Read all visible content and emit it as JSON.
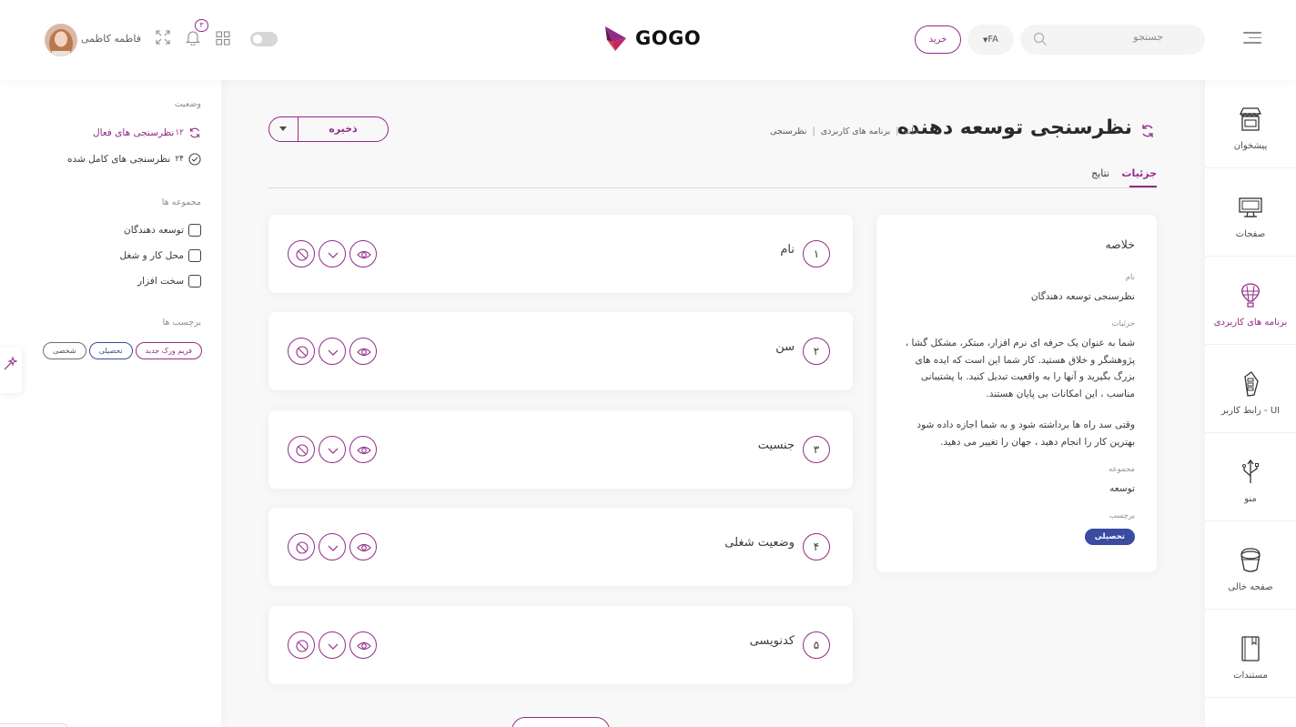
{
  "header": {
    "search_placeholder": "جستجو",
    "language": "FA",
    "buy_label": "خرید",
    "logo_text": "GOGO",
    "notification_count": "۳",
    "user_name": "فاطمه کاظمی"
  },
  "sidebar": {
    "items": [
      {
        "label": "پیشخوان",
        "icon": "shop-icon"
      },
      {
        "label": "صفحات",
        "icon": "monitor-icon"
      },
      {
        "label": "برنامه های کاربردی",
        "icon": "balloon-icon",
        "active": true
      },
      {
        "label": "رابط کاربر - UI",
        "icon": "remote-icon"
      },
      {
        "label": "منو",
        "icon": "usb-icon"
      },
      {
        "label": "صفحه خالی",
        "icon": "bucket-icon"
      },
      {
        "label": "مستندات",
        "icon": "book-icon"
      }
    ]
  },
  "left_panel": {
    "status_heading": "وضعیت",
    "status_items": [
      {
        "count": "۱۲",
        "label": "نظرسنجی های فعال",
        "active": true
      },
      {
        "count": "۲۴",
        "label": "نظرسنجی های کامل شده"
      }
    ],
    "groups_heading": "مجموعه ها",
    "groups": [
      "توسعه دهندگان",
      "محل کار و شغل",
      "سخت افزار"
    ],
    "tags_heading": "برچسب ها",
    "tags": [
      "فریم ورک جدید",
      "تحصیلی",
      "شخصی"
    ]
  },
  "page": {
    "title": "نظرسنجی توسعه دهنده",
    "breadcrumb": [
      "خانه",
      "برنامه های کاربردی",
      "نظرسنجی"
    ],
    "save_label": "ذخیره",
    "tabs": [
      "جزئیات",
      "نتایج"
    ]
  },
  "summary": {
    "title": "خلاصه",
    "name_label": "نام",
    "name_value": "نظرسنجی توسعه دهندگان",
    "details_label": "جزئیات",
    "details_p1": "شما به عنوان یک حرفه ای نرم افزار، مبتکر، مشکل گشا ، پژوهشگر و خلاق هستید. کار شما این است که ایده های بزرگ بگیرید و آنها را به واقعیت تبدیل کنید. با پشتیبانی مناسب ، این امکانات بی پایان هستند.",
    "details_p2": "وقتی سد راه ها برداشته شود و به شما اجازه داده شود بهترین کار را انجام دهید ، جهان را تغییر می دهید.",
    "group_label": "مجموعه",
    "group_value": "توسعه",
    "tag_label": "برچسب",
    "tag_value": "تحصیلی"
  },
  "questions": [
    {
      "num": "۱",
      "label": "نام"
    },
    {
      "num": "۲",
      "label": "سن"
    },
    {
      "num": "۳",
      "label": "جنسیت"
    },
    {
      "num": "۴",
      "label": "وضعیت شغلی"
    },
    {
      "num": "۵",
      "label": "کدنویسی"
    }
  ],
  "colors": {
    "accent": "#922c88",
    "tag_blue": "#3a4ba0"
  }
}
